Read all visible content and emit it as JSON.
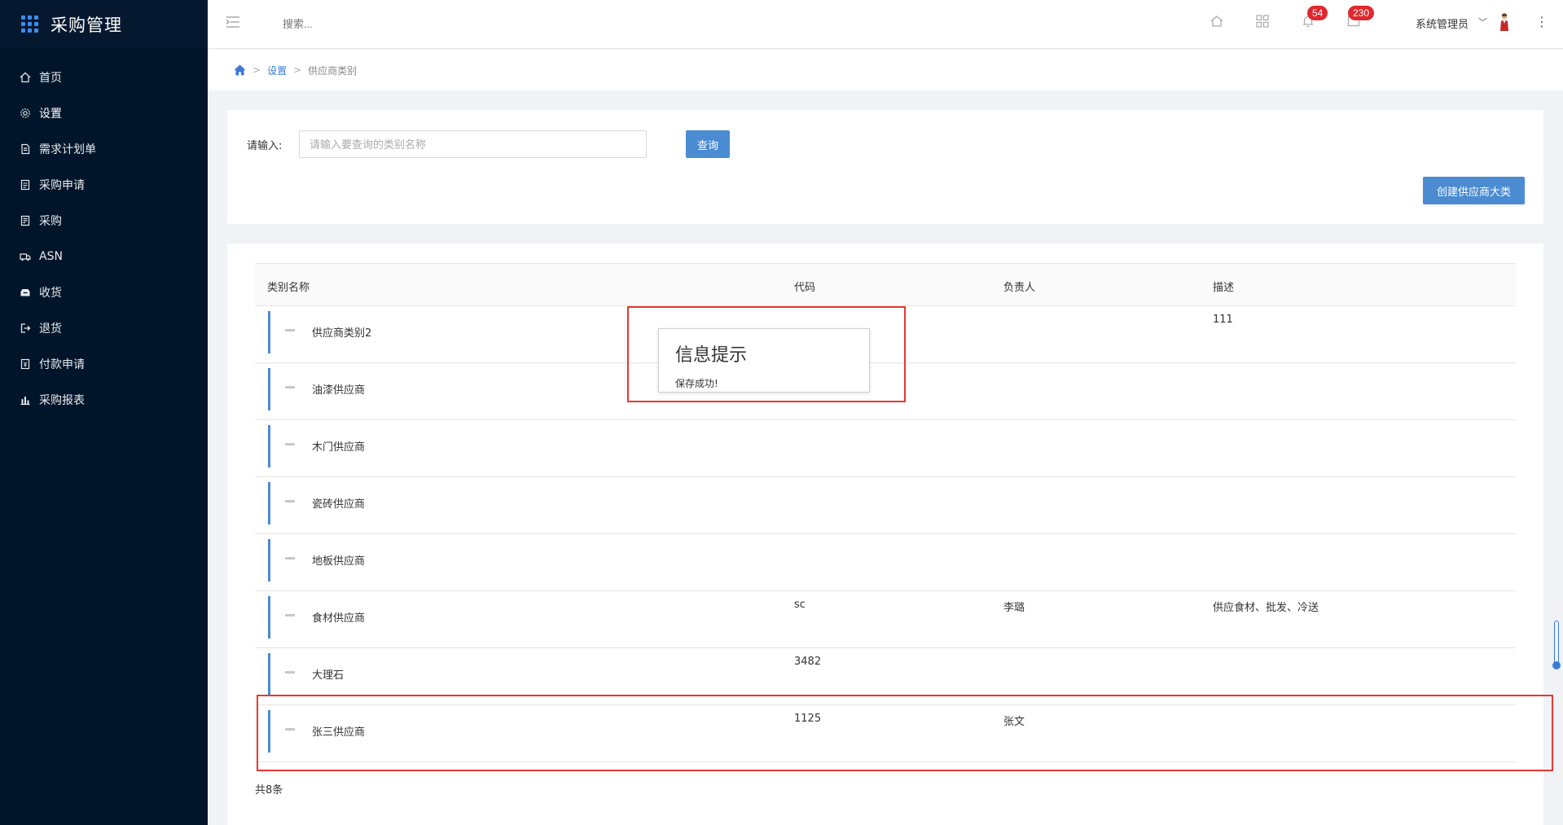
{
  "sidebar": {
    "title": "采购管理",
    "items": [
      {
        "label": "首页",
        "icon": "home-icon"
      },
      {
        "label": "设置",
        "icon": "gear-icon"
      },
      {
        "label": "需求计划单",
        "icon": "document-icon"
      },
      {
        "label": "采购申请",
        "icon": "clipboard-icon"
      },
      {
        "label": "采购",
        "icon": "list-icon"
      },
      {
        "label": "ASN",
        "icon": "truck-icon"
      },
      {
        "label": "收货",
        "icon": "inbox-icon"
      },
      {
        "label": "退货",
        "icon": "return-icon"
      },
      {
        "label": "付款申请",
        "icon": "payment-icon"
      },
      {
        "label": "采购报表",
        "icon": "bar-chart-icon"
      }
    ]
  },
  "header": {
    "search_placeholder": "搜索...",
    "bell_badge": "54",
    "message_badge": "230",
    "user_name": "系统管理员"
  },
  "breadcrumb": {
    "level1": "设置",
    "level2": "供应商类别"
  },
  "search": {
    "label": "请输入:",
    "placeholder": "请输入要查询的类别名称",
    "query_button": "查询",
    "create_button": "创建供应商大类"
  },
  "table": {
    "headers": {
      "name": "类别名称",
      "code": "代码",
      "owner": "负责人",
      "desc": "描述"
    },
    "rows": [
      {
        "name": "供应商类别2",
        "code": "",
        "owner": "",
        "desc": "111"
      },
      {
        "name": "油漆供应商",
        "code": "",
        "owner": "",
        "desc": ""
      },
      {
        "name": "木门供应商",
        "code": "",
        "owner": "",
        "desc": ""
      },
      {
        "name": "瓷砖供应商",
        "code": "",
        "owner": "",
        "desc": ""
      },
      {
        "name": "地板供应商",
        "code": "",
        "owner": "",
        "desc": ""
      },
      {
        "name": "食材供应商",
        "code": "sc",
        "owner": "李璐",
        "desc": "供应食材、批发、冷送"
      },
      {
        "name": "大理石",
        "code": "3482",
        "owner": "",
        "desc": ""
      },
      {
        "name": "张三供应商",
        "code": "1125",
        "owner": "张文",
        "desc": ""
      }
    ],
    "total": "共8条"
  },
  "toast": {
    "title": "信息提示",
    "message": "保存成功!"
  },
  "colors": {
    "sidebar_bg": "#001529",
    "primary": "#4a8bd1",
    "badge": "#e0282e",
    "highlight": "#e53935"
  }
}
